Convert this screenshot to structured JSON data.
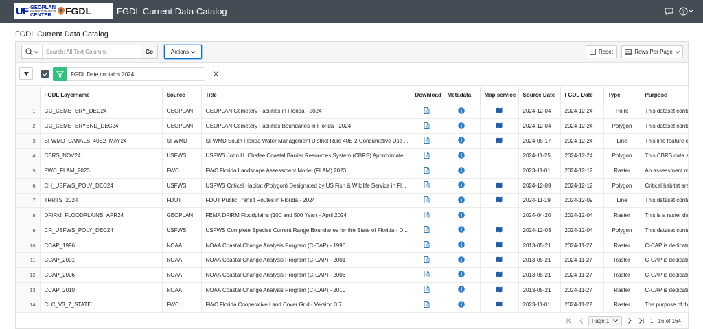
{
  "header": {
    "logo": {
      "uf": "UF",
      "geoplan_line1": "GEOPLAN",
      "geoplan_line2": "CENTER",
      "geoplan_sub": "ADVANCED SPATIAL ANALYSIS",
      "fgdl": "FGDL"
    },
    "app_title": "FGDL Current Data Catalog",
    "icons": [
      "chat-icon",
      "help-icon"
    ]
  },
  "page": {
    "title": "FGDL Current Data Catalog"
  },
  "toolbar": {
    "search_placeholder": "Search: All Text Columns",
    "search_value": "",
    "go_label": "Go",
    "actions_label": "Actions",
    "reset_label": "Reset",
    "rows_per_page_label": "Rows Per Page"
  },
  "filter": {
    "text": "FGDL Date contains 2024",
    "enabled": true
  },
  "table": {
    "columns": [
      "",
      "FGDL Layername",
      "Source",
      "Title",
      "Download",
      "Metadata",
      "Map service",
      "Source Date",
      "FGDL Date",
      "Type",
      "Purpose"
    ],
    "rows": [
      {
        "n": "1",
        "layer": "GC_CEMETERY_DEC24",
        "source": "GEOPLAN",
        "title": "GEOPLAN Cemetery Facilities in Florida - 2024",
        "map": true,
        "source_date": "2024-12-04",
        "fgdl_date": "2024-12-24",
        "type": "Point",
        "purpose": "This dataset contai"
      },
      {
        "n": "2",
        "layer": "GC_CEMETERYBND_DEC24",
        "source": "GEOPLAN",
        "title": "GEOPLAN Cemetery Facilities Boundaries in Florida - 2024",
        "map": true,
        "source_date": "2024-12-04",
        "fgdl_date": "2024-12-24",
        "type": "Polygon",
        "purpose": "This dataset contai"
      },
      {
        "n": "3",
        "layer": "SFWMD_CANALS_40E2_MAY24",
        "source": "SFWMD",
        "title": "SFWMD South Florida Water Management District Rule 40E-2 Consumptive Use ...",
        "map": true,
        "source_date": "2024-05-17",
        "fgdl_date": "2024-12-24",
        "type": "Line",
        "purpose": "This line feature cla"
      },
      {
        "n": "4",
        "layer": "CBRS_NOV24",
        "source": "USFWS",
        "title": "USFWS John H. Chafee Coastal Barrier Resources System (CBRS) Approximate P...",
        "map": false,
        "source_date": "2024-11-25",
        "fgdl_date": "2024-12-24",
        "type": "Polygon",
        "purpose": "This CBRS data set"
      },
      {
        "n": "5",
        "layer": "FWC_FLAM_2023",
        "source": "FWC",
        "title": "FWC Florida Landscape Assessment Model (FLAM) 2023",
        "map": false,
        "source_date": "2023-11-01",
        "fgdl_date": "2024-12-12",
        "type": "Raster",
        "purpose": "An assessment mod"
      },
      {
        "n": "6",
        "layer": "CH_USFWS_POLY_DEC24",
        "source": "USFWS",
        "title": "USFWS Critical Habitat (Polygon) Designated by US Fish & Wildlife Service in Fl...",
        "map": true,
        "source_date": "2024-12-09",
        "fgdl_date": "2024-12-12",
        "type": "Polygon",
        "purpose": "Critical habitat are"
      },
      {
        "n": "7",
        "layer": "TRRTS_2024",
        "source": "FDOT",
        "title": "FDOT Public Transit Routes in Florida - 2024",
        "map": true,
        "source_date": "2024-11-19",
        "fgdl_date": "2024-12-09",
        "type": "Line",
        "purpose": "This dataset contai"
      },
      {
        "n": "8",
        "layer": "DFIRM_FLOODPLAINS_APR24",
        "source": "GEOPLAN",
        "title": "FEMA DFIRM Floodplains (100 and 500 Year) - April 2024",
        "map": false,
        "source_date": "2024-04-20",
        "fgdl_date": "2024-12-04",
        "type": "Raster",
        "purpose": "This is a raster data"
      },
      {
        "n": "9",
        "layer": "CR_USFWS_POLY_DEC24",
        "source": "USFWS",
        "title": "USFWS Complete Species Current Range Boundaries for the State of Florida - D...",
        "map": true,
        "source_date": "2024-12-03",
        "fgdl_date": "2024-12-04",
        "type": "Polygon",
        "purpose": "This dataset contai"
      },
      {
        "n": "10",
        "layer": "CCAP_1996",
        "source": "NOAA",
        "title": "NOAA Coastal Change Analysis Program (C-CAP) - 1996",
        "map": true,
        "source_date": "2013-05-21",
        "fgdl_date": "2024-11-27",
        "type": "Raster",
        "purpose": "C-CAP is dedicated"
      },
      {
        "n": "11",
        "layer": "CCAP_2001",
        "source": "NOAA",
        "title": "NOAA Coastal Change Analysis Program (C-CAP) - 2001",
        "map": true,
        "source_date": "2013-05-21",
        "fgdl_date": "2024-11-27",
        "type": "Raster",
        "purpose": "C-CAP is dedicated"
      },
      {
        "n": "12",
        "layer": "CCAP_2006",
        "source": "NOAA",
        "title": "NOAA Coastal Change Analysis Program (C-CAP) - 2006",
        "map": true,
        "source_date": "2013-05-21",
        "fgdl_date": "2024-11-27",
        "type": "Raster",
        "purpose": "C-CAP is dedicated"
      },
      {
        "n": "13",
        "layer": "CCAP_2010",
        "source": "NOAA",
        "title": "NOAA Coastal Change Analysis Program (C-CAP) - 2010",
        "map": true,
        "source_date": "2013-05-21",
        "fgdl_date": "2024-11-27",
        "type": "Raster",
        "purpose": "C-CAP is dedicated"
      },
      {
        "n": "14",
        "layer": "CLC_V3_7_STATE",
        "source": "FWC",
        "title": "FWC Florida Cooperative Land Cover Grid - Version 3.7",
        "map": true,
        "source_date": "2023-11-01",
        "fgdl_date": "2024-11-22",
        "type": "Raster",
        "purpose": "The purpose of the"
      }
    ]
  },
  "pagination": {
    "page_label": "Page 1",
    "range": "1 - 16 of 164"
  },
  "colors": {
    "header_bg": "#444d56",
    "accent": "#0572ce",
    "filter_green": "#2ec27e",
    "icon_blue": "#2a7fc9",
    "map_blue": "#1f5ea8"
  }
}
